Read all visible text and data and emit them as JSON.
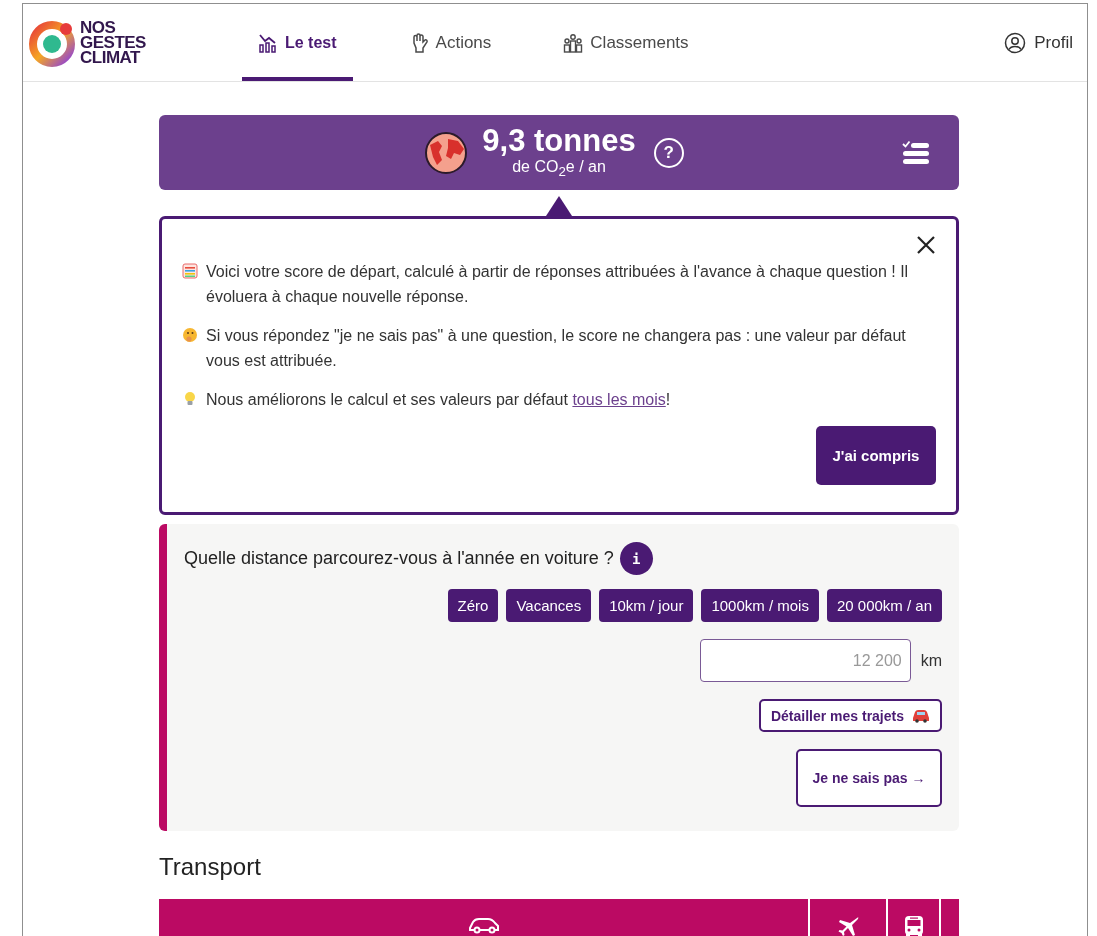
{
  "header": {
    "logo_lines": [
      "NOS",
      "GESTES",
      "CLIMAT"
    ],
    "nav": [
      {
        "label": "Le test",
        "kind": "chart",
        "selected": true
      },
      {
        "label": "Actions",
        "kind": "hand",
        "selected": false
      },
      {
        "label": "Classements",
        "kind": "people",
        "selected": false
      }
    ],
    "profile": "Profil"
  },
  "score": {
    "value": "9,3 tonnes",
    "unit": "de CO$_{2}$e / an",
    "help": "?"
  },
  "notice": {
    "paragraphs": [
      {
        "kind": "list",
        "text": "Voici votre score de départ, calculé à partir de réponses attribuées à l'avance à chaque question ! Il évoluera à chaque nouvelle réponse."
      },
      {
        "kind": "think",
        "text": "Si vous répondez \"je ne sais pas\" à une question, le score ne changera pas : une valeur par défaut vous est attribuée."
      },
      {
        "kind": "bulb",
        "text": "Nous améliorons le calcul et ses valeurs par défaut ",
        "link": "tous les mois",
        "after": "!"
      }
    ],
    "confirm": "J'ai compris"
  },
  "question": {
    "text": "Quelle distance parcourez-vous à l'année en voiture ?",
    "info": "i",
    "suggestions": [
      "Zéro",
      "Vacances",
      "10km / jour",
      "1000km / mois",
      "20 000km / an"
    ],
    "input": {
      "placeholder": "12 200",
      "unit": "km"
    },
    "detail": "Détailler mes trajets",
    "skip": "Je ne sais pas →"
  },
  "section": {
    "title": "Transport",
    "tabs": [
      {
        "kind": "car"
      },
      {
        "kind": "plane"
      },
      {
        "kind": "bus"
      },
      {
        "kind": "other"
      }
    ]
  }
}
